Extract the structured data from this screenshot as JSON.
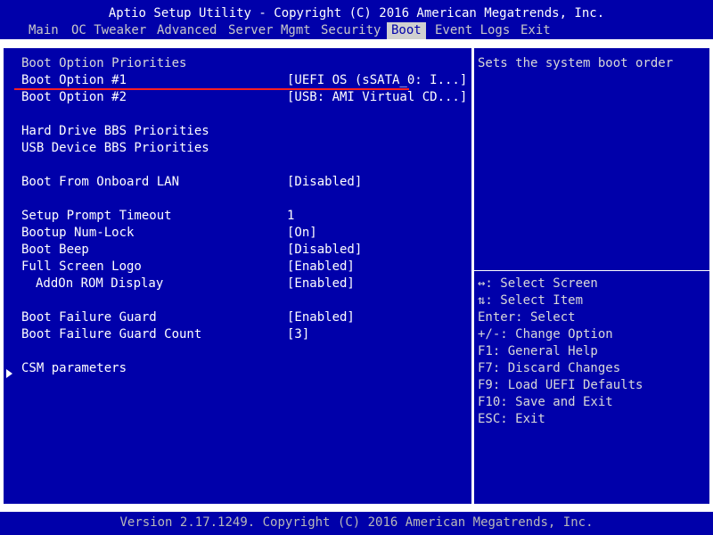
{
  "header": {
    "title": "Aptio Setup Utility - Copyright (C) 2016 American Megatrends, Inc.",
    "menu": [
      {
        "label": "Main",
        "active": false
      },
      {
        "label": "OC Tweaker",
        "active": false
      },
      {
        "label": "Advanced",
        "active": false
      },
      {
        "label": "Server Mgmt",
        "active": false
      },
      {
        "label": "Security",
        "active": false
      },
      {
        "label": "Boot",
        "active": true
      },
      {
        "label": "Event Logs",
        "active": false
      },
      {
        "label": "Exit",
        "active": false
      }
    ]
  },
  "boot": {
    "section_title": "Boot Option Priorities",
    "option1_label": "Boot Option #1",
    "option1_value": "[UEFI OS (sSATA_0: I...]",
    "option2_label": "Boot Option #2",
    "option2_value": "[USB: AMI Virtual CD...]",
    "hdd_bbs": "Hard Drive BBS Priorities",
    "usb_bbs": "USB Device BBS Priorities",
    "lan_label": "Boot From Onboard LAN",
    "lan_value": "[Disabled]",
    "timeout_label": "Setup Prompt Timeout",
    "timeout_value": "1",
    "numlock_label": "Bootup Num-Lock",
    "numlock_value": "[On]",
    "beep_label": "Boot Beep",
    "beep_value": "[Disabled]",
    "logo_label": "Full Screen Logo",
    "logo_value": "[Enabled]",
    "addon_label": "AddOn ROM Display",
    "addon_value": "[Enabled]",
    "guard_label": "Boot Failure Guard",
    "guard_value": "[Enabled]",
    "guard_count_label": "Boot Failure Guard Count",
    "guard_count_value": "[3]",
    "csm_label": "CSM parameters"
  },
  "help": {
    "description": "Sets the system boot order",
    "keys": [
      "↔: Select Screen",
      "⇅: Select Item",
      "Enter: Select",
      "+/-: Change Option",
      "F1: General Help",
      "F7: Discard Changes",
      "F9: Load UEFI Defaults",
      "F10: Save and Exit",
      "ESC: Exit"
    ]
  },
  "footer": {
    "text": "Version 2.17.1249. Copyright (C) 2016 American Megatrends, Inc."
  }
}
